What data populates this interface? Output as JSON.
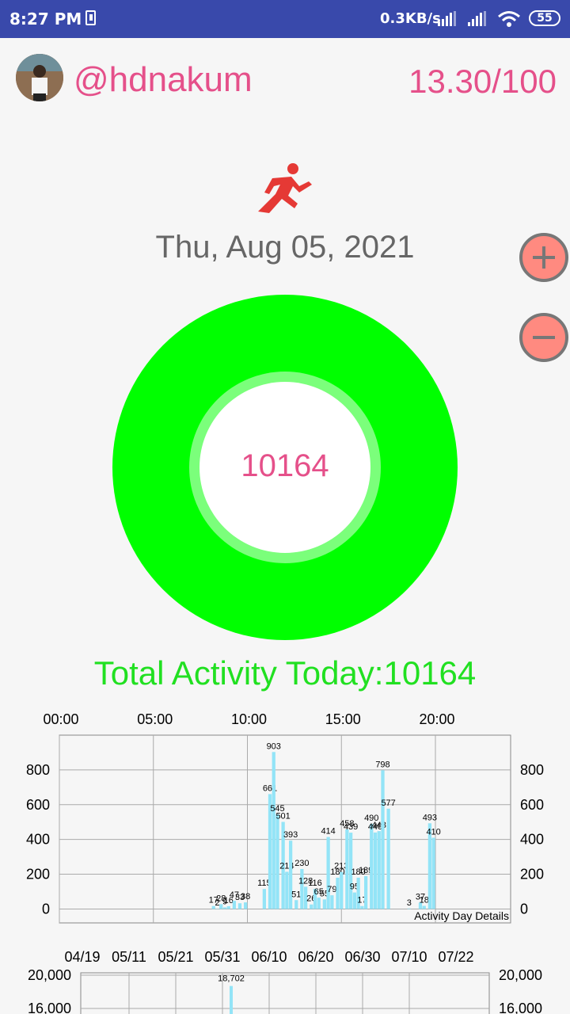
{
  "status_bar": {
    "time": "8:27 PM",
    "net_speed": "0.3KB/s",
    "battery": "55"
  },
  "profile": {
    "username": "@hdnakum",
    "progress": "13.30/100"
  },
  "date": "Thu, Aug 05, 2021",
  "donut": {
    "steps": "10164",
    "ring_color": "#00ff00"
  },
  "total_label": "Total Activity Today:10164",
  "icons": [
    "runner-icon",
    "plus-icon",
    "minus-icon",
    "sim-icon",
    "signal-icon",
    "wifi-icon",
    "battery-icon"
  ],
  "colors": {
    "status_bar": "#3949ab",
    "accent_pink": "#e5508a",
    "green": "#21e021",
    "bar": "#93e4f7",
    "fab": "#ff8a80"
  },
  "chart_data": [
    {
      "type": "bar",
      "x_tick_labels": [
        "00:00",
        "05:00",
        "10:00",
        "15:00",
        "20:00"
      ],
      "x_tick_positions": [
        0,
        5,
        10,
        15,
        20
      ],
      "xlim": [
        0,
        24
      ],
      "ylim": [
        -80,
        1000
      ],
      "y_ticks": [
        0,
        200,
        400,
        600,
        800
      ],
      "grid": true,
      "corner_label": "Activity Day Details",
      "labels": [
        "17",
        "2",
        "28",
        "9",
        "16",
        "47",
        "33",
        "38",
        "115",
        "661",
        "903",
        "545",
        "501",
        "214",
        "393",
        "51",
        "230",
        "128",
        "26",
        "116",
        "65",
        "55",
        "414",
        "79",
        "180",
        "213",
        "458",
        "439",
        "95",
        "180",
        "17",
        "189",
        "490",
        "440",
        "448",
        "798",
        "577",
        "3",
        "37",
        "18",
        "493",
        "410"
      ],
      "x": [
        8.2,
        8.4,
        8.6,
        8.8,
        9.0,
        9.3,
        9.6,
        9.9,
        10.9,
        11.2,
        11.4,
        11.6,
        11.9,
        12.1,
        12.3,
        12.6,
        12.9,
        13.1,
        13.4,
        13.6,
        13.8,
        14.1,
        14.3,
        14.5,
        14.8,
        15.0,
        15.3,
        15.5,
        15.7,
        15.9,
        16.1,
        16.3,
        16.6,
        16.8,
        17.0,
        17.2,
        17.5,
        18.6,
        19.2,
        19.4,
        19.7,
        19.9
      ],
      "values": [
        17,
        2,
        28,
        9,
        16,
        47,
        33,
        38,
        115,
        661,
        903,
        545,
        501,
        214,
        393,
        51,
        230,
        128,
        26,
        116,
        65,
        55,
        414,
        79,
        180,
        213,
        458,
        439,
        95,
        180,
        17,
        189,
        490,
        440,
        448,
        798,
        577,
        3,
        37,
        18,
        493,
        410
      ]
    },
    {
      "type": "bar",
      "categories": [
        "04/19",
        "05/11",
        "05/21",
        "05/31",
        "06/10",
        "06/20",
        "06/30",
        "07/10",
        "07/22"
      ],
      "y_ticks": [
        "20,000",
        "16,000"
      ],
      "labels": [
        "18,702"
      ],
      "values": [
        18702
      ]
    }
  ]
}
